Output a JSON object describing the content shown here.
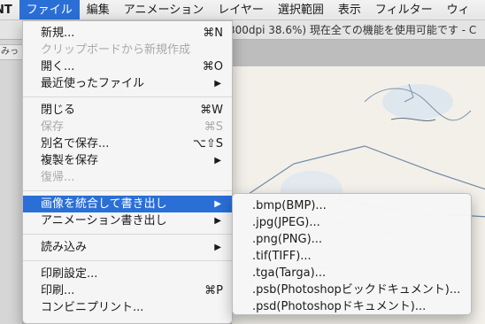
{
  "menubar": {
    "app_fragment": "NT",
    "items": [
      "ファイル",
      "編集",
      "アニメーション",
      "レイヤー",
      "選択範囲",
      "表示",
      "フィルター",
      "ウィ"
    ]
  },
  "document": {
    "title_fragment": "300dpi 38.6%)  現在全ての機能を使用可能です - C",
    "tab_fragment": "みっjh"
  },
  "file_menu": {
    "new": {
      "label": "新規...",
      "shortcut": "⌘N"
    },
    "new_from_clipboard": {
      "label": "クリップボードから新規作成"
    },
    "open": {
      "label": "開く...",
      "shortcut": "⌘O"
    },
    "recent": {
      "label": "最近使ったファイル",
      "arrow": "▶"
    },
    "close": {
      "label": "閉じる",
      "shortcut": "⌘W"
    },
    "save": {
      "label": "保存",
      "shortcut": "⌘S"
    },
    "save_as": {
      "label": "別名で保存...",
      "shortcut": "⌥⇧S"
    },
    "save_copy": {
      "label": "複製を保存",
      "arrow": "▶"
    },
    "revert": {
      "label": "復帰..."
    },
    "export_merged": {
      "label": "画像を統合して書き出し",
      "arrow": "▶"
    },
    "export_animation": {
      "label": "アニメーション書き出し",
      "arrow": "▶"
    },
    "import": {
      "label": "読み込み",
      "arrow": "▶"
    },
    "print_settings": {
      "label": "印刷設定..."
    },
    "print": {
      "label": "印刷...",
      "shortcut": "⌘P"
    },
    "convenience_print": {
      "label": "コンビニプリント..."
    }
  },
  "export_submenu": [
    ".bmp(BMP)...",
    ".jpg(JPEG)...",
    ".png(PNG)...",
    ".tif(TIFF)...",
    ".tga(Targa)...",
    ".psb(Photoshopビックドキュメント)...",
    ".psd(Photoshopドキュメント)..."
  ],
  "colors": {
    "highlight": "#2a6fd6",
    "disabled_text": "#a9a9a9"
  }
}
